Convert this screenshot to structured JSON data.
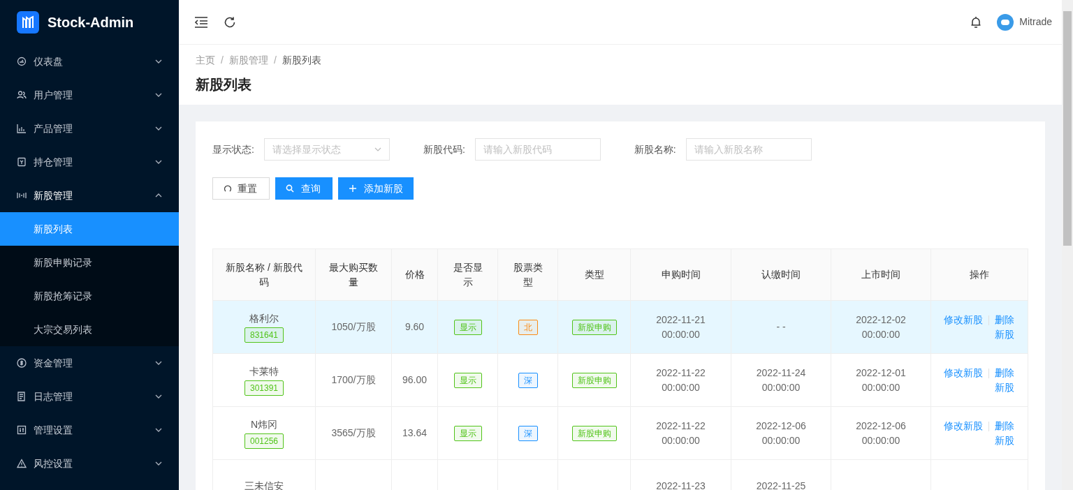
{
  "sidebar": {
    "logo_text": "Stock-Admin",
    "items": [
      {
        "label": "仪表盘",
        "expanded": false
      },
      {
        "label": "用户管理",
        "expanded": false
      },
      {
        "label": "产品管理",
        "expanded": false
      },
      {
        "label": "持仓管理",
        "expanded": false
      },
      {
        "label": "新股管理",
        "expanded": true,
        "children": [
          {
            "label": "新股列表",
            "selected": true
          },
          {
            "label": "新股申购记录",
            "selected": false
          },
          {
            "label": "新股抢筹记录",
            "selected": false
          },
          {
            "label": "大宗交易列表",
            "selected": false
          }
        ]
      },
      {
        "label": "资金管理",
        "expanded": false
      },
      {
        "label": "日志管理",
        "expanded": false
      },
      {
        "label": "管理设置",
        "expanded": false
      },
      {
        "label": "风控设置",
        "expanded": false
      }
    ]
  },
  "header": {
    "user": "Mitrade"
  },
  "breadcrumb": [
    {
      "kind": "link",
      "text": "主页"
    },
    {
      "kind": "separator",
      "text": "/"
    },
    {
      "kind": "link",
      "text": "新股管理"
    },
    {
      "kind": "separator",
      "text": "/"
    },
    {
      "kind": "current",
      "text": "新股列表"
    }
  ],
  "page_title": "新股列表",
  "filters": [
    {
      "kind": "select",
      "label": "显示状态:",
      "placeholder": "请选择显示状态"
    },
    {
      "kind": "input",
      "label": "新股代码:",
      "placeholder": "请输入新股代码"
    },
    {
      "kind": "input",
      "label": "新股名称:",
      "placeholder": "请输入新股名称"
    }
  ],
  "buttons": [
    {
      "kind": "reset",
      "label": "重置"
    },
    {
      "kind": "search",
      "label": "查询"
    },
    {
      "kind": "add",
      "label": "添加新股"
    }
  ],
  "table": {
    "columns": [
      "新股名称 / 新股代码",
      "最大购买数量",
      "价格",
      "是否显示",
      "股票类型",
      "类型",
      "申购时间",
      "认缴时间",
      "上市时间",
      "操作"
    ],
    "rows": [
      {
        "highlighted": true,
        "name": "格利尔",
        "code": "831641",
        "quantity": "1050/万股",
        "price": "9.60",
        "display": "显示",
        "exchange": {
          "text": "北",
          "color": "#fa8c16"
        },
        "type": "新股申购",
        "subscribe_time": "2022-11-21 00:00:00",
        "pay_time": "- -",
        "listing_time": "2022-12-02 00:00:00",
        "actions": [
          "修改新股",
          "删除新股"
        ]
      },
      {
        "highlighted": false,
        "name": "卡莱特",
        "code": "301391",
        "quantity": "1700/万股",
        "price": "96.00",
        "display": "显示",
        "exchange": {
          "text": "深",
          "color": "#1890ff"
        },
        "type": "新股申购",
        "subscribe_time": "2022-11-22 00:00:00",
        "pay_time": "2022-11-24 00:00:00",
        "listing_time": "2022-12-01 00:00:00",
        "actions": [
          "修改新股",
          "删除新股"
        ]
      },
      {
        "highlighted": false,
        "name": "N炜冈",
        "code": "001256",
        "quantity": "3565/万股",
        "price": "13.64",
        "display": "显示",
        "exchange": {
          "text": "深",
          "color": "#1890ff"
        },
        "type": "新股申购",
        "subscribe_time": "2022-11-22 00:00:00",
        "pay_time": "2022-12-06 00:00:00",
        "listing_time": "2022-12-06 00:00:00",
        "actions": [
          "修改新股",
          "删除新股"
        ]
      },
      {
        "highlighted": false,
        "name": "三未信安",
        "subscribe_time": "2022-11-23",
        "pay_time": "2022-11-25"
      }
    ]
  }
}
